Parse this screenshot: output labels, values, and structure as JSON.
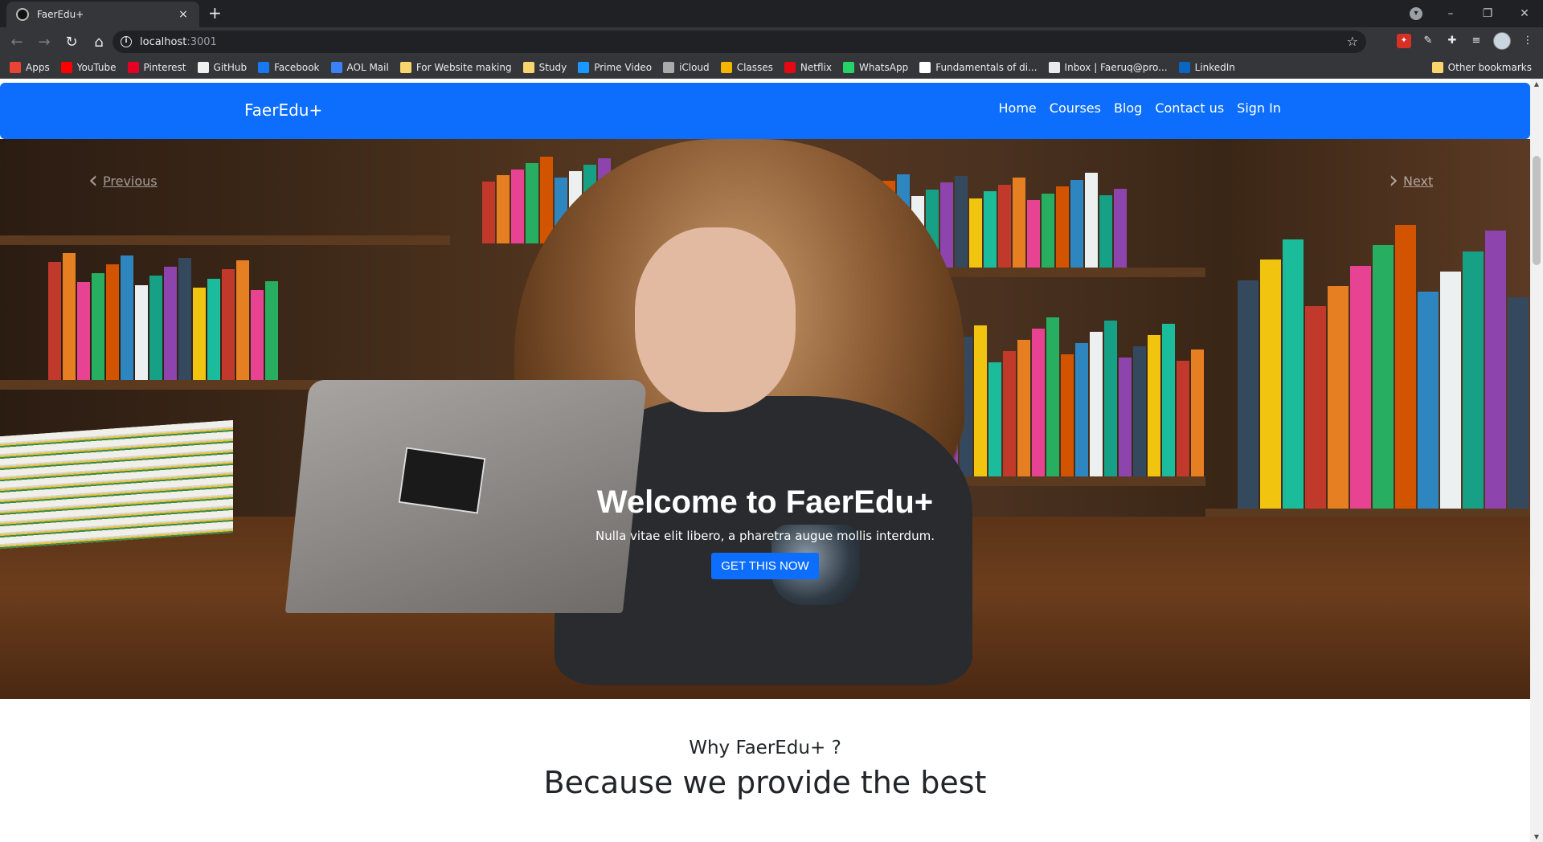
{
  "browser": {
    "tab_title": "FaerEdu+",
    "tab_close": "×",
    "new_tab": "+",
    "url_host": "localhost",
    "url_port": ":3001",
    "window_controls": [
      "–",
      "❐",
      "✕"
    ],
    "bookmarks": [
      {
        "label": "Apps",
        "icon": "apps-grid-icon",
        "color": "#ea4335"
      },
      {
        "label": "YouTube",
        "icon": "youtube-icon",
        "color": "#ff0000"
      },
      {
        "label": "Pinterest",
        "icon": "pinterest-icon",
        "color": "#e60023"
      },
      {
        "label": "GitHub",
        "icon": "github-icon",
        "color": "#f0f0f0"
      },
      {
        "label": "Facebook",
        "icon": "facebook-icon",
        "color": "#1877f2"
      },
      {
        "label": "AOL Mail",
        "icon": "aol-icon",
        "color": "#3b82f6"
      },
      {
        "label": "For Website making",
        "icon": "folder-icon",
        "color": "#f9d56e"
      },
      {
        "label": "Study",
        "icon": "folder-icon",
        "color": "#f9d56e"
      },
      {
        "label": "Prime Video",
        "icon": "prime-video-icon",
        "color": "#1a98ff"
      },
      {
        "label": "iCloud",
        "icon": "apple-icon",
        "color": "#aaaaaa"
      },
      {
        "label": "Classes",
        "icon": "classroom-icon",
        "color": "#f4b400"
      },
      {
        "label": "Netflix",
        "icon": "netflix-icon",
        "color": "#e50914"
      },
      {
        "label": "WhatsApp",
        "icon": "whatsapp-icon",
        "color": "#25d366"
      },
      {
        "label": "Fundamentals of di...",
        "icon": "google-icon",
        "color": "#ffffff"
      },
      {
        "label": "Inbox | Faeruq@pro...",
        "icon": "lock-icon",
        "color": "#e8eaed"
      },
      {
        "label": "LinkedIn",
        "icon": "linkedin-icon",
        "color": "#0a66c2"
      }
    ],
    "other_bookmarks": "Other bookmarks"
  },
  "navbar": {
    "brand": "FaerEdu+",
    "links": [
      "Home",
      "Courses",
      "Blog",
      "Contact us",
      "Sign In"
    ],
    "color": "#0d6efd"
  },
  "carousel": {
    "prev_label": "Previous",
    "next_label": "Next",
    "caption_title": "Welcome to FaerEdu+",
    "caption_text": "Nulla vitae elit libero, a pharetra augue mollis interdum.",
    "cta_label": "GET THIS NOW"
  },
  "why": {
    "subtitle": "Why FaerEdu+ ?",
    "title": "Because we provide the best"
  }
}
